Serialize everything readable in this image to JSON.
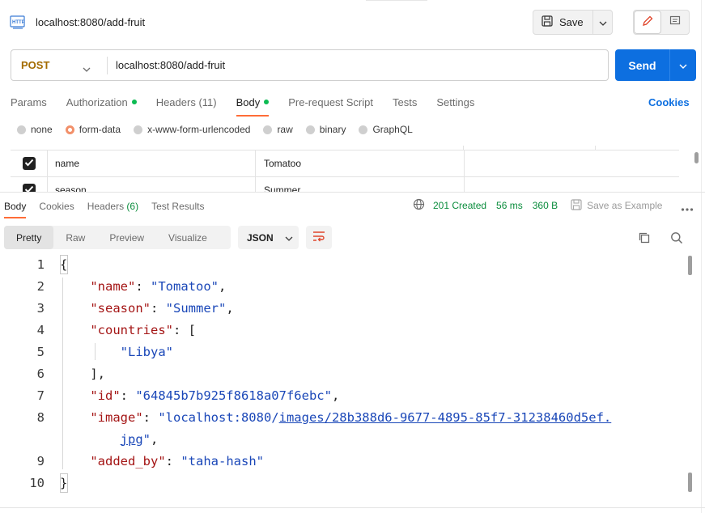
{
  "request": {
    "title": "localhost:8080/add-fruit",
    "method": "POST",
    "url": "localhost:8080/add-fruit",
    "save_label": "Save",
    "send_label": "Send",
    "http_badge": "HTTP"
  },
  "request_tabs": [
    {
      "label": "Params",
      "suffix": ""
    },
    {
      "label": "Authorization",
      "suffix": ""
    },
    {
      "label": "Headers",
      "suffix": " (11)"
    },
    {
      "label": "Body",
      "suffix": ""
    },
    {
      "label": "Pre-request Script",
      "suffix": ""
    },
    {
      "label": "Tests",
      "suffix": ""
    },
    {
      "label": "Settings",
      "suffix": ""
    }
  ],
  "cookies_label": "Cookies",
  "body_types": [
    "none",
    "form-data",
    "x-www-form-urlencoded",
    "raw",
    "binary",
    "GraphQL"
  ],
  "selected_body_type": "form-data",
  "form_rows": [
    {
      "key": "name",
      "value": "Tomatoo",
      "checked": true
    },
    {
      "key": "season",
      "value": "Summer",
      "checked": true
    }
  ],
  "response_tabs": [
    {
      "label": "Body",
      "count": ""
    },
    {
      "label": "Cookies",
      "count": ""
    },
    {
      "label": "Headers",
      "count": "(6)"
    },
    {
      "label": "Test Results",
      "count": ""
    }
  ],
  "status": {
    "code": "201 Created",
    "time": "56 ms",
    "size": "360 B",
    "save_example": "Save as Example"
  },
  "view_tabs": [
    "Pretty",
    "Raw",
    "Preview",
    "Visualize"
  ],
  "format": "JSON",
  "colors": {
    "accent": "#ff6c37",
    "send": "#0d6fe0",
    "status_green": "#0a8c3c",
    "json_key": "#a41515",
    "json_string": "#1a47b8",
    "method": "#a36b00"
  },
  "code_lines": [
    {
      "n": "1",
      "parts": [
        [
          "p",
          "{"
        ]
      ]
    },
    {
      "n": "2",
      "parts": [
        [
          "p",
          "    "
        ],
        [
          "k",
          "\"name\""
        ],
        [
          "p",
          ": "
        ],
        [
          "s",
          "\"Tomatoo\""
        ],
        [
          "p",
          ","
        ]
      ]
    },
    {
      "n": "3",
      "parts": [
        [
          "p",
          "    "
        ],
        [
          "k",
          "\"season\""
        ],
        [
          "p",
          ": "
        ],
        [
          "s",
          "\"Summer\""
        ],
        [
          "p",
          ","
        ]
      ]
    },
    {
      "n": "4",
      "parts": [
        [
          "p",
          "    "
        ],
        [
          "k",
          "\"countries\""
        ],
        [
          "p",
          ": ["
        ]
      ]
    },
    {
      "n": "5",
      "parts": [
        [
          "p",
          "        "
        ],
        [
          "s",
          "\"Libya\""
        ]
      ]
    },
    {
      "n": "6",
      "parts": [
        [
          "p",
          "    ],"
        ]
      ]
    },
    {
      "n": "7",
      "parts": [
        [
          "p",
          "    "
        ],
        [
          "k",
          "\"id\""
        ],
        [
          "p",
          ": "
        ],
        [
          "s",
          "\"64845b7b925f8618a07f6ebc\""
        ],
        [
          "p",
          ","
        ]
      ]
    },
    {
      "n": "8",
      "parts": [
        [
          "p",
          "    "
        ],
        [
          "k",
          "\"image\""
        ],
        [
          "p",
          ": "
        ],
        [
          "s",
          "\"localhost:8080/"
        ],
        [
          "l",
          "images/28b388d6-9677-4895-85f7-31238460d5ef."
        ]
      ]
    },
    {
      "n": "",
      "parts": [
        [
          "p",
          "        "
        ],
        [
          "l",
          "jpg"
        ],
        [
          "s",
          "\""
        ],
        [
          "p",
          ","
        ]
      ]
    },
    {
      "n": "9",
      "parts": [
        [
          "p",
          "    "
        ],
        [
          "k",
          "\"added_by\""
        ],
        [
          "p",
          ": "
        ],
        [
          "s",
          "\"taha-hash\""
        ]
      ]
    },
    {
      "n": "10",
      "parts": [
        [
          "p",
          "}"
        ]
      ]
    }
  ]
}
